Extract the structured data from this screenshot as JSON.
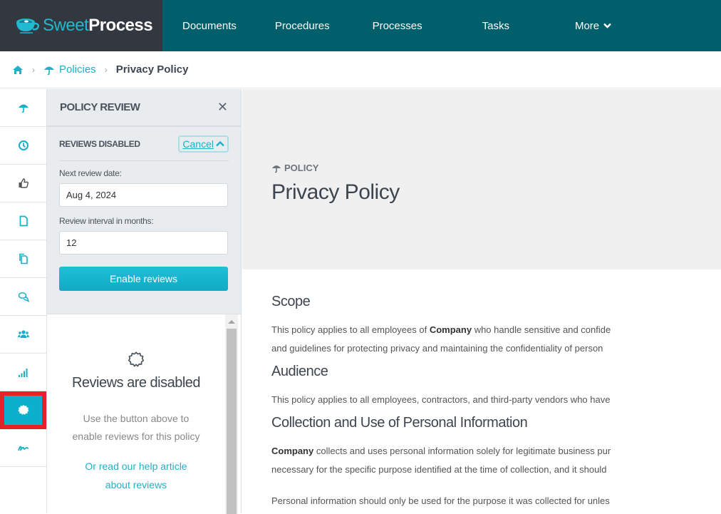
{
  "app": {
    "logo_sweet": "Sweet",
    "logo_process": "Process",
    "colors": {
      "brand_teal": "#005f6b",
      "accent": "#0cb0cd",
      "logo_dark": "#33373f",
      "highlight_red": "#e8202a"
    }
  },
  "nav": {
    "items": [
      {
        "label": "Documents"
      },
      {
        "label": "Procedures"
      },
      {
        "label": "Processes"
      },
      {
        "label": "Tasks"
      },
      {
        "label": "More"
      }
    ]
  },
  "breadcrumb": {
    "home_icon": "home-icon",
    "items": [
      {
        "label": "Policies",
        "icon": "umbrella-icon"
      },
      {
        "label": "Privacy Policy"
      }
    ]
  },
  "sidebar_icons": [
    {
      "name": "umbrella-icon"
    },
    {
      "name": "clock-icon"
    },
    {
      "name": "thumbs-up-icon"
    },
    {
      "name": "file-icon"
    },
    {
      "name": "copy-icon"
    },
    {
      "name": "comments-icon"
    },
    {
      "name": "users-icon"
    },
    {
      "name": "signal-icon"
    },
    {
      "name": "badge-icon",
      "active": true
    },
    {
      "name": "signature-icon"
    }
  ],
  "review_panel": {
    "title": "POLICY REVIEW",
    "status_label": "REVIEWS DISABLED",
    "cancel_label": "Cancel",
    "next_review_label": "Next review date:",
    "next_review_value": "Aug 4, 2024",
    "interval_label": "Review interval in months:",
    "interval_value": "12",
    "enable_button": "Enable reviews",
    "empty_title": "Reviews are disabled",
    "empty_desc_1": "Use the button above to",
    "empty_desc_2": "enable reviews for this policy",
    "help_link_1": "Or read our help article",
    "help_link_2": "about reviews"
  },
  "document": {
    "kicker": "POLICY",
    "title": "Privacy Policy",
    "sections": [
      {
        "heading": "Scope",
        "line1_pre": "This policy applies to all employees of ",
        "line1_bold": "Company",
        "line1_post": " who handle sensitive and confide",
        "line2": "and guidelines for protecting privacy and maintaining the confidentiality of person"
      },
      {
        "heading": "Audience",
        "line1": "This policy applies to all employees, contractors, and third-party vendors who have"
      },
      {
        "heading": "Collection and Use of Personal Information",
        "line1_bold": "Company",
        "line1_post": " collects and uses personal information solely for legitimate business pur",
        "line2": "necessary for the specific purpose identified at the time of collection, and it should",
        "line3": "Personal information should only be used for the purpose it was collected for unles"
      }
    ]
  }
}
